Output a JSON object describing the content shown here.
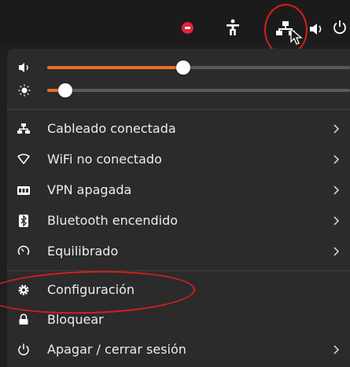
{
  "top_bar": {
    "icons": [
      "do-not-disturb-icon",
      "accessibility-icon",
      "wired-network-icon",
      "volume-icon",
      "power-icon"
    ]
  },
  "sliders": {
    "volume": {
      "icon": "speaker-icon",
      "level": 0.45
    },
    "brightness": {
      "icon": "sun-icon",
      "level": 0.06
    }
  },
  "menu": {
    "wired": {
      "icon": "wired-network-icon",
      "label": "Cableado conectada"
    },
    "wifi": {
      "icon": "wifi-icon",
      "label": "WiFi no conectado"
    },
    "vpn": {
      "icon": "vpn-icon",
      "label": "VPN apagada"
    },
    "bluetooth": {
      "icon": "bluetooth-icon",
      "label": "Bluetooth encendido"
    },
    "power_mode": {
      "icon": "power-mode-icon",
      "label": "Equilibrado"
    },
    "settings": {
      "icon": "gear-icon",
      "label": "Configuración"
    },
    "lock": {
      "icon": "lock-icon",
      "label": "Bloquear"
    },
    "power_off": {
      "icon": "power-icon",
      "label": "Apagar / cerrar sesión"
    }
  },
  "colors": {
    "accent": "#ef6b2d",
    "annotation": "#d81d1d",
    "panel": "#2b2b2b",
    "topbar": "#1b1b1b"
  }
}
